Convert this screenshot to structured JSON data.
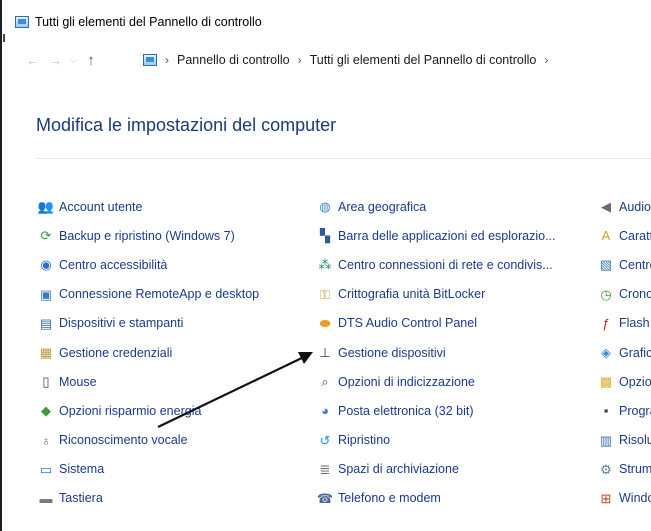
{
  "window": {
    "title": "Tutti gli elementi del Pannello di controllo"
  },
  "nav": {
    "back_icon": "back-arrow-icon",
    "forward_icon": "forward-arrow-icon",
    "recent_icon": "chevron-down-icon",
    "up_icon": "up-arrow-icon",
    "breadcrumb": [
      "Pannello di controllo",
      "Tutti gli elementi del Pannello di controllo"
    ],
    "separator": "›"
  },
  "main": {
    "heading": "Modifica le impostazioni del computer"
  },
  "columns": [
    [
      {
        "label": "Account utente",
        "icon": "users-icon",
        "color": "#5a8a3a"
      },
      {
        "label": "Backup e ripristino (Windows 7)",
        "icon": "backup-icon",
        "color": "#3a9a3a"
      },
      {
        "label": "Centro accessibilità",
        "icon": "accessibility-icon",
        "color": "#2a6ad0"
      },
      {
        "label": "Connessione RemoteApp e desktop",
        "icon": "remoteapp-icon",
        "color": "#3a7ac0"
      },
      {
        "label": "Dispositivi e stampanti",
        "icon": "printer-icon",
        "color": "#3a6a9a"
      },
      {
        "label": "Gestione credenziali",
        "icon": "credential-icon",
        "color": "#c09a3a"
      },
      {
        "label": "Mouse",
        "icon": "mouse-icon",
        "color": "#444444"
      },
      {
        "label": "Opzioni risparmio energia",
        "icon": "power-icon",
        "color": "#3a9a3a"
      },
      {
        "label": "Riconoscimento vocale",
        "icon": "microphone-icon",
        "color": "#6a6a6a"
      },
      {
        "label": "Sistema",
        "icon": "system-icon",
        "color": "#2a7ad0"
      },
      {
        "label": "Tastiera",
        "icon": "keyboard-icon",
        "color": "#7a7a7a"
      }
    ],
    [
      {
        "label": "Area geografica",
        "icon": "globe-icon",
        "color": "#3a8ac0"
      },
      {
        "label": "Barra delle applicazioni ed esplorazio...",
        "icon": "taskbar-icon",
        "color": "#2a5a9a"
      },
      {
        "label": "Centro connessioni di rete e condivis...",
        "icon": "network-icon",
        "color": "#2a8a5a"
      },
      {
        "label": "Crittografia unità BitLocker",
        "icon": "bitlocker-icon",
        "color": "#c0a03a"
      },
      {
        "label": "DTS Audio Control Panel",
        "icon": "dts-icon",
        "color": "#f09a2a"
      },
      {
        "label": "Gestione dispositivi",
        "icon": "device-manager-icon",
        "color": "#3a3a3a"
      },
      {
        "label": "Opzioni di indicizzazione",
        "icon": "indexing-icon",
        "color": "#3a6ab0"
      },
      {
        "label": "Posta elettronica (32 bit)",
        "icon": "mail-icon",
        "color": "#3a7ad0"
      },
      {
        "label": "Ripristino",
        "icon": "recovery-icon",
        "color": "#2a8ae0"
      },
      {
        "label": "Spazi di archiviazione",
        "icon": "storage-icon",
        "color": "#6a6a6a"
      },
      {
        "label": "Telefono e modem",
        "icon": "phone-modem-icon",
        "color": "#4a6a9a"
      }
    ],
    [
      {
        "label": "Audio",
        "icon": "speaker-icon",
        "color": "#6a6a6a"
      },
      {
        "label": "Caratteri",
        "icon": "fonts-icon",
        "color": "#d0a020"
      },
      {
        "label": "Centro",
        "icon": "center-icon",
        "color": "#3a7ab0"
      },
      {
        "label": "Cronologia",
        "icon": "history-icon",
        "color": "#3aa03a"
      },
      {
        "label": "Flash",
        "icon": "flash-icon",
        "color": "#c02020"
      },
      {
        "label": "Grafica",
        "icon": "graphics-icon",
        "color": "#3a8ad0"
      },
      {
        "label": "Opzioni",
        "icon": "options-icon",
        "color": "#e0b030"
      },
      {
        "label": "Programmi",
        "icon": "programs-icon",
        "color": "#2a4a6a"
      },
      {
        "label": "Risoluzione",
        "icon": "troubleshoot-icon",
        "color": "#3a6ab0"
      },
      {
        "label": "Strumenti",
        "icon": "tools-icon",
        "color": "#5a7a9a"
      },
      {
        "label": "Windows",
        "icon": "windows-icon",
        "color": "#c04020"
      }
    ]
  ],
  "overlay": {
    "arrow_color": "#111111"
  },
  "colors": {
    "link": "#1a3a8a",
    "heading": "#1a3a78"
  }
}
